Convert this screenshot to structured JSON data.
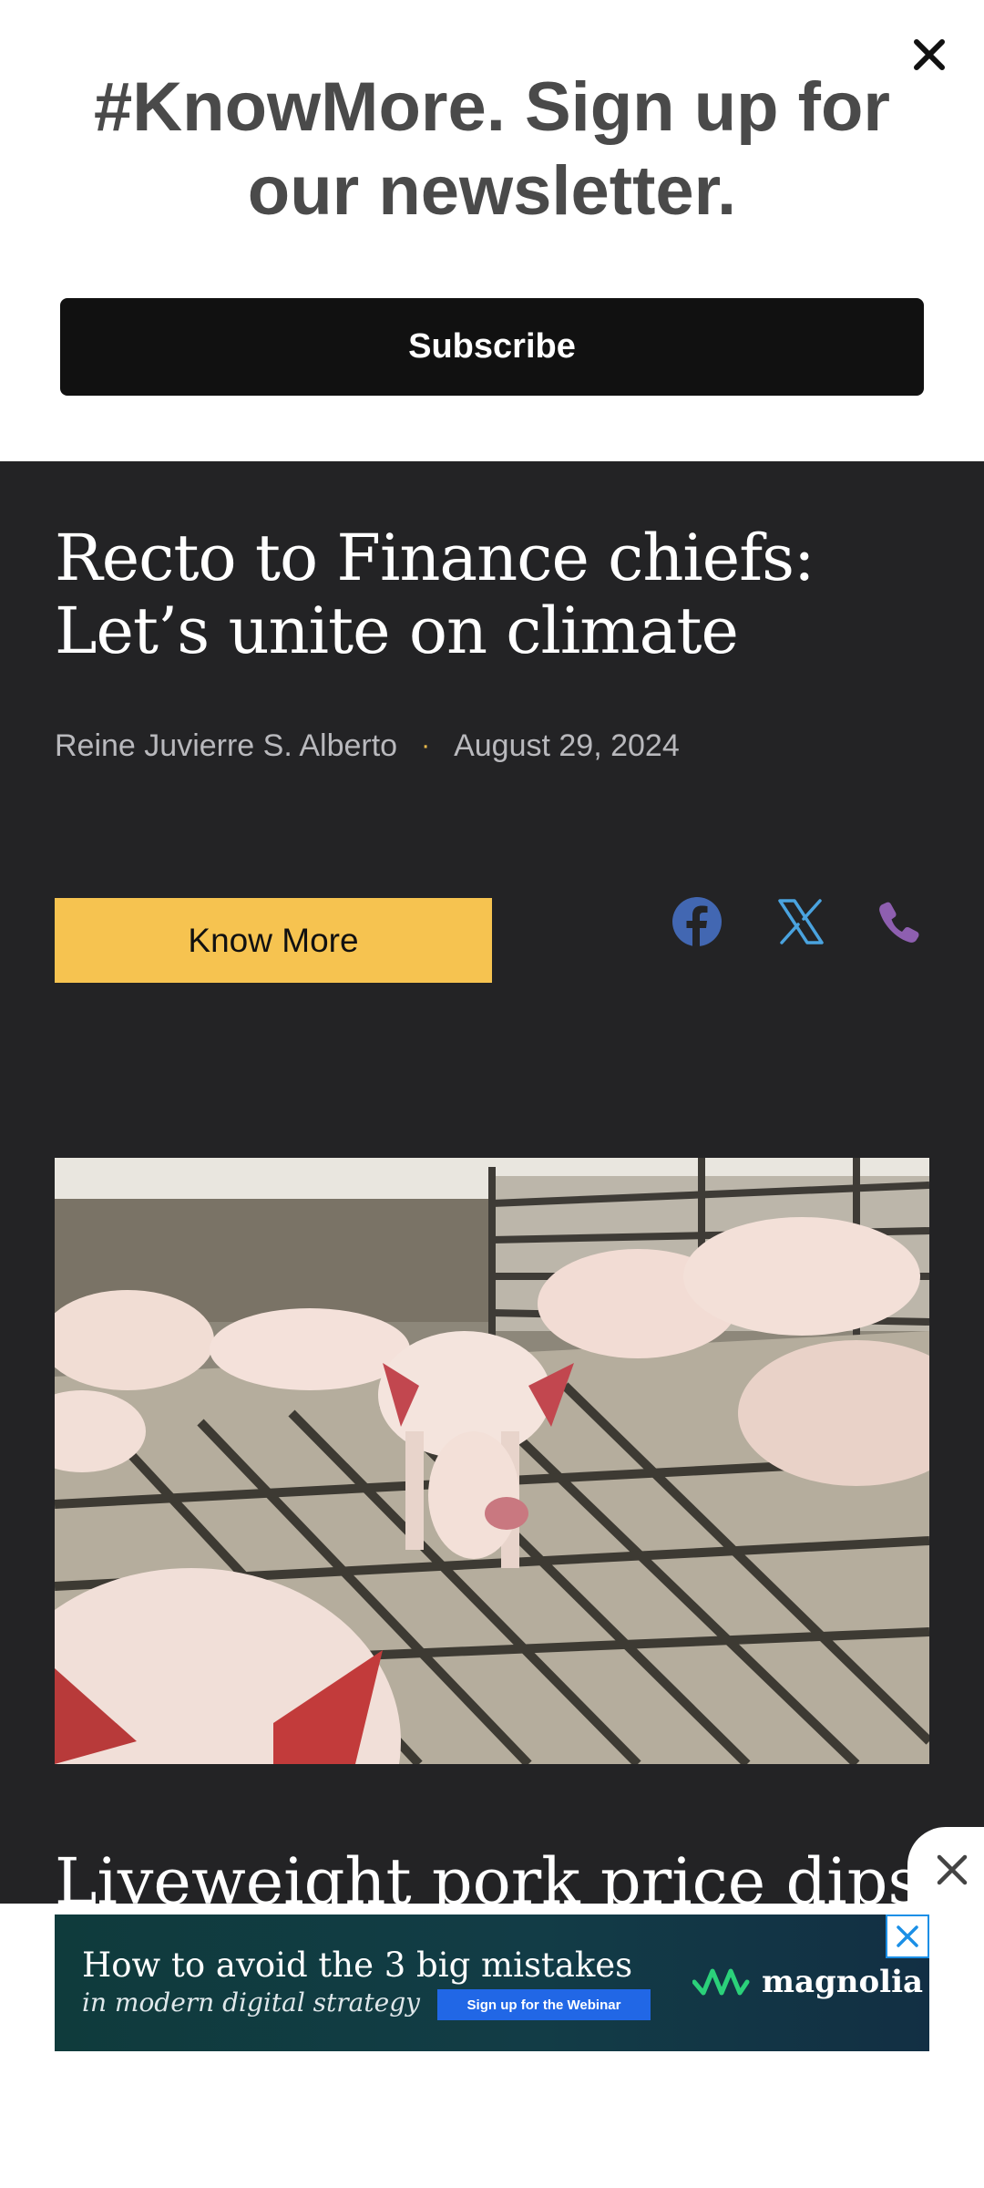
{
  "newsletter": {
    "heading": "#KnowMore. Sign up for our newsletter.",
    "subscribe_label": "Subscribe",
    "close_icon": "close-icon"
  },
  "article": {
    "title": "Recto to Finance chiefs: Let’s unite on climate",
    "author": "Reine Juvierre S. Alberto",
    "separator": "·",
    "date": "August 29, 2024",
    "know_more_label": "Know More",
    "share_icons": [
      "facebook-icon",
      "x-icon",
      "phone-icon"
    ],
    "next_title": "Liveweight pork price dips"
  },
  "ad": {
    "line1": "How to avoid the 3 big mistakes",
    "line2": "in modern digital strategy",
    "cta": "Sign up for the Webinar",
    "brand": "magnolia"
  },
  "colors": {
    "accent": "#f6c350",
    "article_bg": "#232325",
    "facebook": "#4267b2",
    "x_brand": "#4aa3df",
    "phone": "#8e5fb0"
  }
}
